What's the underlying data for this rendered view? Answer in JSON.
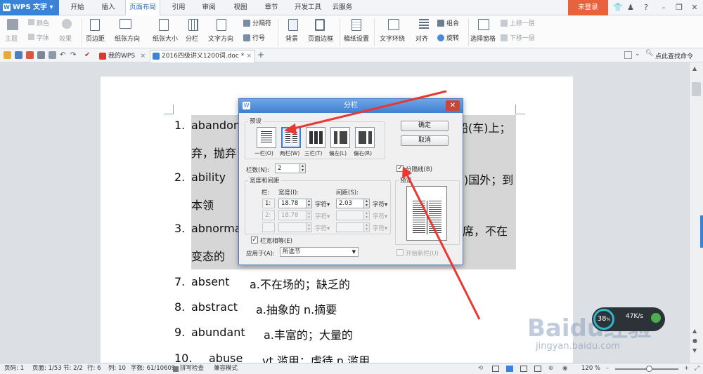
{
  "app": {
    "name": "WPS 文字",
    "login": "未登录"
  },
  "menu_tabs": [
    {
      "label": "开始"
    },
    {
      "label": "插入"
    },
    {
      "label": "页面布局"
    },
    {
      "label": "引用"
    },
    {
      "label": "审阅"
    },
    {
      "label": "视图"
    },
    {
      "label": "章节"
    },
    {
      "label": "开发工具"
    },
    {
      "label": "云服务"
    }
  ],
  "ribbon": {
    "theme": "主题",
    "color": "颜色",
    "font": "字体",
    "effect": "效果",
    "margins": "页边距",
    "orientation": "纸张方向",
    "size": "纸张大小",
    "columns": "分栏",
    "text_direction": "文字方向",
    "separator": "分隔符",
    "line_numbers": "行号",
    "background": "背景",
    "page_border": "页面边框",
    "draft_paper": "稿纸设置",
    "wrap_text": "文字环绕",
    "align": "对齐",
    "group": "组合",
    "rotate": "旋转",
    "selection_pane": "选择窗格",
    "bring_forward": "上移一层",
    "send_backward": "下移一层"
  },
  "doc_tabs": [
    {
      "label": "我的WPS"
    },
    {
      "label": "2016四级讲义1200词.doc *"
    }
  ],
  "search_label": "点此查找命令",
  "document": {
    "lines": [
      {
        "num": "1.",
        "word": "abandon",
        "rest": "船(车)上；"
      },
      {
        "num": "",
        "word": "弃，抛弃",
        "rest": ""
      },
      {
        "num": "2.",
        "word": "ability",
        "rest": ")国外；到"
      },
      {
        "num": "",
        "word": "本领",
        "rest": ""
      },
      {
        "num": "3.",
        "word": "abnorma",
        "rest": "席，不在"
      },
      {
        "num": "",
        "word": "变态的",
        "rest": ""
      },
      {
        "num": "7.",
        "word": "absent",
        "rest": "a.不在场的；缺乏的"
      },
      {
        "num": "8.",
        "word": "abstract",
        "rest": "a.抽象的    n.摘要"
      },
      {
        "num": "9.",
        "word": "abundant",
        "rest": "a.丰富的；大量的"
      },
      {
        "num": "10.",
        "word": "abuse",
        "rest": "vt.滥用；虐待    n.滥用"
      }
    ]
  },
  "dialog": {
    "title": "分栏",
    "presets_label": "预设",
    "presets": [
      {
        "label": "一栏(O)"
      },
      {
        "label": "两栏(W)"
      },
      {
        "label": "三栏(T)"
      },
      {
        "label": "偏左(L)"
      },
      {
        "label": "偏右(R)"
      }
    ],
    "ok": "确定",
    "cancel": "取消",
    "col_count_label": "栏数(N):",
    "col_count": "2",
    "divider_label": "分隔线(B)",
    "width_spacing_label": "宽度和间距",
    "col_header": "栏:",
    "width_header": "宽度(I):",
    "spacing_header": "间距(S):",
    "rows": [
      {
        "col": "1:",
        "width": "18.78",
        "unit": "字符▾",
        "spacing": "2.03",
        "unit2": "字符▾"
      },
      {
        "col": "2:",
        "width": "18.78",
        "unit": "字符▾",
        "spacing": "",
        "unit2": "字符▾"
      },
      {
        "col": "",
        "width": "",
        "unit": "字符▾",
        "spacing": "",
        "unit2": "字符▾"
      }
    ],
    "preview_label": "预览",
    "equal_width_label": "栏宽相等(E)",
    "apply_label": "应用于(A):",
    "apply_value": "所选节",
    "new_col_label": "开始新栏(U)"
  },
  "status": {
    "page": "页码: 1",
    "pages": "页面: 1/53",
    "section": "节: 2/2",
    "row": "行: 6",
    "col": "列: 10",
    "words": "字数: 61/10609",
    "spell": "拼写检查",
    "compat": "兼容模式",
    "zoom": "120 %"
  },
  "watermark": {
    "brand": "Baidu经验",
    "url": "jingyan.baidu.com"
  },
  "gauge": {
    "value": "38",
    "unit": "%",
    "speed": "47K/s"
  }
}
